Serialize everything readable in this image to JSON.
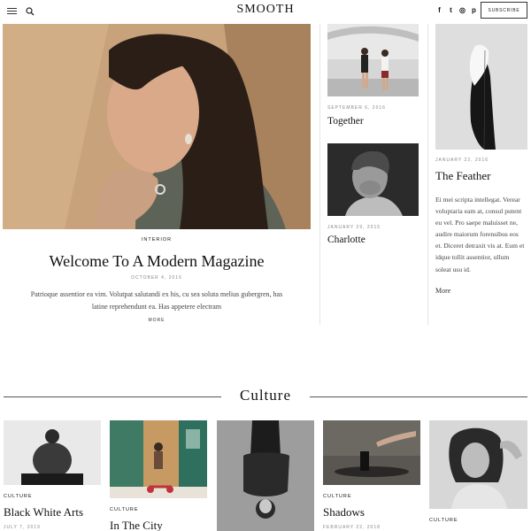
{
  "header": {
    "logo": "SMOOTH",
    "social": [
      "f",
      "t",
      "◎",
      "p"
    ],
    "subscribe_label": "SUBSCRIBE"
  },
  "featured": {
    "category": "INTERIOR",
    "title": "Welcome To A Modern Magazine",
    "date": "OCTOBER 4, 2016",
    "excerpt": "Patrioque assentior ea vim. Volutpat salutandi ex his, cu sea soluta melius gubergren, has latine reprehendunt ea. Has appetere electram",
    "more": "MORE"
  },
  "middle_posts": [
    {
      "date": "SEPTEMBER 6, 2016",
      "title": "Together"
    },
    {
      "date": "JANUARY 29, 2015",
      "title": "Charlotte"
    }
  ],
  "right_post": {
    "date": "JANUARY 22, 2016",
    "title": "The Feather",
    "excerpt": "Ei mei scripta intellegat. Verear voluptaria eam at, consul putent eu vel. Pro saepe maluisset ne, audire maiorum forensibus eos et. Diceret detraxit vis at. Eum et idque tollit assentior, ullum soleat usu id.",
    "more": "More"
  },
  "culture": {
    "heading": "Culture",
    "cards": [
      {
        "category": "CULTURE",
        "title": "Black White Arts",
        "date": "JULY 7, 2019"
      },
      {
        "category": "CULTURE",
        "title": "In The City",
        "date": ""
      },
      {
        "category": "",
        "title": "",
        "date": ""
      },
      {
        "category": "CULTURE",
        "title": "Shadows",
        "date": "FEBRUARY 22, 2018"
      },
      {
        "category": "CULTURE",
        "title": "",
        "date": ""
      }
    ]
  }
}
